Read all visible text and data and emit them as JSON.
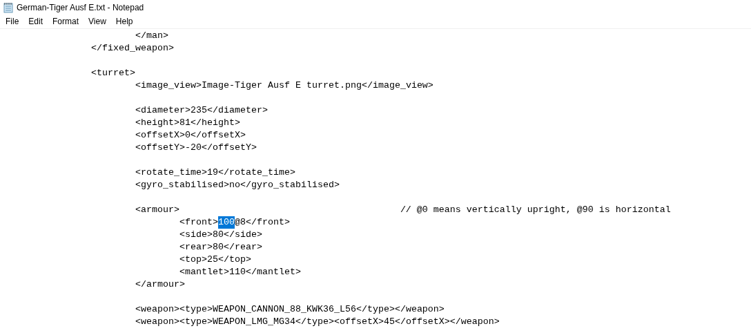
{
  "window": {
    "title": "German-Tiger Ausf E.txt - Notepad"
  },
  "menu": [
    {
      "label": "File"
    },
    {
      "label": "Edit"
    },
    {
      "label": "Format"
    },
    {
      "label": "View"
    },
    {
      "label": "Help"
    }
  ],
  "editor": {
    "lines": [
      {
        "kind": "text",
        "segments": [
          {
            "text": "\t\t\t</man>",
            "selected": false
          }
        ]
      },
      {
        "kind": "text",
        "segments": [
          {
            "text": "\t\t</fixed_weapon>",
            "selected": false
          }
        ]
      },
      {
        "kind": "blank"
      },
      {
        "kind": "text",
        "segments": [
          {
            "text": "\t\t<turret>",
            "selected": false
          }
        ]
      },
      {
        "kind": "text",
        "segments": [
          {
            "text": "\t\t\t<image_view>Image-Tiger Ausf E turret.png</image_view>",
            "selected": false
          }
        ]
      },
      {
        "kind": "blank"
      },
      {
        "kind": "text",
        "segments": [
          {
            "text": "\t\t\t<diameter>235</diameter>",
            "selected": false
          }
        ]
      },
      {
        "kind": "text",
        "segments": [
          {
            "text": "\t\t\t<height>81</height>",
            "selected": false
          }
        ]
      },
      {
        "kind": "text",
        "segments": [
          {
            "text": "\t\t\t<offsetX>0</offsetX>",
            "selected": false
          }
        ]
      },
      {
        "kind": "text",
        "segments": [
          {
            "text": "\t\t\t<offsetY>-20</offsetY>",
            "selected": false
          }
        ]
      },
      {
        "kind": "blank"
      },
      {
        "kind": "text",
        "segments": [
          {
            "text": "\t\t\t<rotate_time>19</rotate_time>",
            "selected": false
          }
        ]
      },
      {
        "kind": "text",
        "segments": [
          {
            "text": "\t\t\t<gyro_stabilised>no</gyro_stabilised>",
            "selected": false
          }
        ]
      },
      {
        "kind": "blank"
      },
      {
        "kind": "text",
        "segments": [
          {
            "text": "\t\t\t<armour>\t\t\t\t\t// @0 means vertically upright, @90 is horizontal",
            "selected": false
          }
        ]
      },
      {
        "kind": "text",
        "segments": [
          {
            "text": "\t\t\t\t<front>",
            "selected": false
          },
          {
            "text": "100",
            "selected": true
          },
          {
            "text": "@8</front>",
            "selected": false
          }
        ]
      },
      {
        "kind": "text",
        "segments": [
          {
            "text": "\t\t\t\t<side>80</side>",
            "selected": false
          }
        ]
      },
      {
        "kind": "text",
        "segments": [
          {
            "text": "\t\t\t\t<rear>80</rear>",
            "selected": false
          }
        ]
      },
      {
        "kind": "text",
        "segments": [
          {
            "text": "\t\t\t\t<top>25</top>",
            "selected": false
          }
        ]
      },
      {
        "kind": "text",
        "segments": [
          {
            "text": "\t\t\t\t<mantlet>110</mantlet>",
            "selected": false
          }
        ]
      },
      {
        "kind": "text",
        "segments": [
          {
            "text": "\t\t\t</armour>",
            "selected": false
          }
        ]
      },
      {
        "kind": "blank"
      },
      {
        "kind": "text",
        "segments": [
          {
            "text": "\t\t\t<weapon><type>WEAPON_CANNON_88_KWK36_L56</type></weapon>",
            "selected": false
          }
        ]
      },
      {
        "kind": "text",
        "segments": [
          {
            "text": "\t\t\t<weapon><type>WEAPON_LMG_MG34</type><offsetX>45</offsetX></weapon>",
            "selected": false
          }
        ]
      }
    ]
  }
}
